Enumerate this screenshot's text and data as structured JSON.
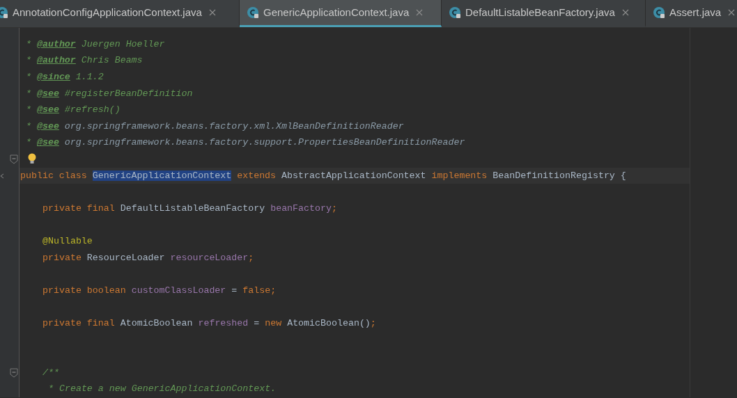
{
  "tabs": [
    {
      "label": "AnnotationConfigApplicationContext.java",
      "selected": false
    },
    {
      "label": "GenericApplicationContext.java",
      "selected": true
    },
    {
      "label": "DefaultListableBeanFactory.java",
      "selected": false
    },
    {
      "label": "Assert.java",
      "selected": false
    }
  ],
  "editor": {
    "lines": [
      {
        "kind": "doc",
        "tokens": [
          {
            "kind": "comment",
            "text": "* "
          },
          {
            "kind": "doctag",
            "text": "@author"
          },
          {
            "kind": "comment",
            "text": " Juergen Hoeller"
          }
        ]
      },
      {
        "kind": "doc",
        "tokens": [
          {
            "kind": "comment",
            "text": "* "
          },
          {
            "kind": "doctag",
            "text": "@author"
          },
          {
            "kind": "comment",
            "text": " Chris Beams"
          }
        ]
      },
      {
        "kind": "doc",
        "tokens": [
          {
            "kind": "comment",
            "text": "* "
          },
          {
            "kind": "doctag",
            "text": "@since"
          },
          {
            "kind": "comment",
            "text": " 1.1.2"
          }
        ]
      },
      {
        "kind": "doc",
        "tokens": [
          {
            "kind": "comment",
            "text": "* "
          },
          {
            "kind": "doctag",
            "text": "@see"
          },
          {
            "kind": "comment",
            "text": " #registerBeanDefinition"
          }
        ]
      },
      {
        "kind": "doc",
        "tokens": [
          {
            "kind": "comment",
            "text": "* "
          },
          {
            "kind": "doctag",
            "text": "@see"
          },
          {
            "kind": "comment",
            "text": " #refresh()"
          }
        ]
      },
      {
        "kind": "doc",
        "tokens": [
          {
            "kind": "comment",
            "text": "* "
          },
          {
            "kind": "doctag",
            "text": "@see"
          },
          {
            "kind": "commentref",
            "text": " org.springframework.beans.factory.xml.XmlBeanDefinitionReader"
          }
        ]
      },
      {
        "kind": "doc",
        "tokens": [
          {
            "kind": "comment",
            "text": "* "
          },
          {
            "kind": "doctag",
            "text": "@see"
          },
          {
            "kind": "commentref",
            "text": " org.springframework.beans.factory.support.PropertiesBeanDefinitionReader"
          }
        ]
      },
      {
        "kind": "blank",
        "fold": true,
        "bulb": true
      },
      {
        "kind": "top",
        "current": true,
        "tokens": [
          {
            "kind": "keyword",
            "text": "public class "
          },
          {
            "kind": "selection",
            "text": "GenericApplicationContext"
          },
          {
            "kind": "keyword",
            "text": " extends"
          },
          {
            "kind": "plain",
            "text": " AbstractApplicationContext "
          },
          {
            "kind": "keyword",
            "text": "implements"
          },
          {
            "kind": "plain",
            "text": " BeanDefinitionRegistry {"
          }
        ]
      },
      {
        "kind": "blank"
      },
      {
        "kind": "member",
        "tokens": [
          {
            "kind": "keyword",
            "text": "private final"
          },
          {
            "kind": "plain",
            "text": " DefaultListableBeanFactory "
          },
          {
            "kind": "field",
            "text": "beanFactory"
          },
          {
            "kind": "keyword",
            "text": ";"
          }
        ]
      },
      {
        "kind": "blank"
      },
      {
        "kind": "member",
        "tokens": [
          {
            "kind": "annotation",
            "text": "@Nullable"
          }
        ]
      },
      {
        "kind": "member",
        "tokens": [
          {
            "kind": "keyword",
            "text": "private"
          },
          {
            "kind": "plain",
            "text": " ResourceLoader "
          },
          {
            "kind": "field",
            "text": "resourceLoader"
          },
          {
            "kind": "keyword",
            "text": ";"
          }
        ]
      },
      {
        "kind": "blank"
      },
      {
        "kind": "member",
        "tokens": [
          {
            "kind": "keyword",
            "text": "private boolean "
          },
          {
            "kind": "field",
            "text": "customClassLoader"
          },
          {
            "kind": "plain",
            "text": " = "
          },
          {
            "kind": "keyword",
            "text": "false;"
          }
        ]
      },
      {
        "kind": "blank"
      },
      {
        "kind": "member",
        "tokens": [
          {
            "kind": "keyword",
            "text": "private final"
          },
          {
            "kind": "plain",
            "text": " AtomicBoolean "
          },
          {
            "kind": "field",
            "text": "refreshed"
          },
          {
            "kind": "plain",
            "text": " = "
          },
          {
            "kind": "keyword",
            "text": "new"
          },
          {
            "kind": "plain",
            "text": " AtomicBoolean()"
          },
          {
            "kind": "keyword",
            "text": ";"
          }
        ]
      },
      {
        "kind": "blank"
      },
      {
        "kind": "blank"
      },
      {
        "kind": "member",
        "fold": true,
        "tokens": [
          {
            "kind": "comment",
            "text": "/**"
          }
        ]
      },
      {
        "kind": "member_doc",
        "tokens": [
          {
            "kind": "comment",
            "text": "* Create a new GenericApplicationContext."
          }
        ]
      }
    ]
  }
}
